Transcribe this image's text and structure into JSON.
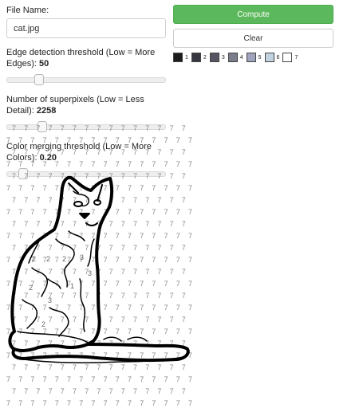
{
  "filename": {
    "label": "File Name:",
    "value": "cat.jpg"
  },
  "controls": [
    {
      "label": "Edge detection threshold (Low = More Edges):",
      "value": "50",
      "level": 0.2
    },
    {
      "label": "Number of superpixels (Low = Less Detail):",
      "value": "2258",
      "level": 0.22
    },
    {
      "label": "Color merging threshold (Low = More Colors):",
      "value": "0.20",
      "level": 0.1
    }
  ],
  "buttons": {
    "compute": "Compute",
    "clear": "Clear"
  },
  "palette": [
    {
      "num": "1",
      "color": "#1c1c1f"
    },
    {
      "num": "2",
      "color": "#373740"
    },
    {
      "num": "3",
      "color": "#555561"
    },
    {
      "num": "4",
      "color": "#7a7d8c"
    },
    {
      "num": "5",
      "color": "#9fa3bc"
    },
    {
      "num": "6",
      "color": "#c2d3df"
    },
    {
      "num": "7",
      "color": "#ffffff"
    }
  ],
  "canvas": {
    "bg_label": "7",
    "region_labels": [
      "2",
      "2",
      "2",
      "3",
      "3",
      "1",
      "3",
      "2",
      "2"
    ]
  }
}
